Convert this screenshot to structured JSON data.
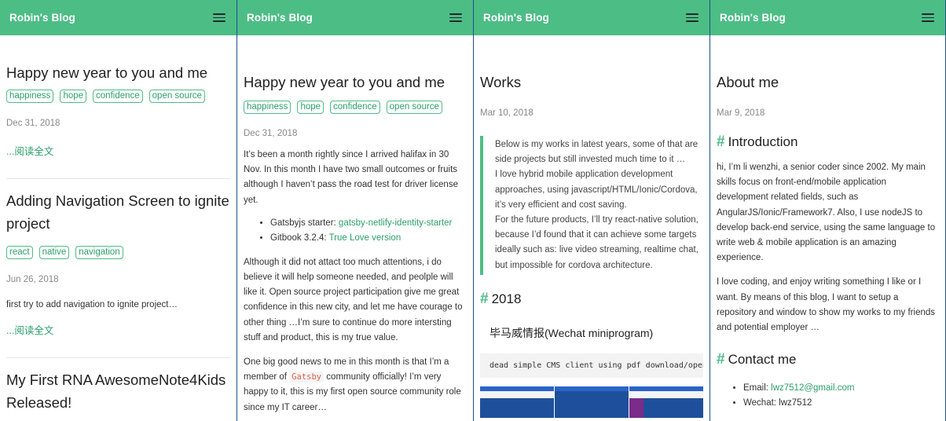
{
  "site": {
    "brand": "Robin's Blog"
  },
  "panel1": {
    "posts": [
      {
        "title": "Happy new year to you and me",
        "tags": [
          "happiness",
          "hope",
          "confidence",
          "open source"
        ],
        "date": "Dec 31, 2018",
        "excerpt": "",
        "read_more": "...阅读全文"
      },
      {
        "title": "Adding Navigation Screen to ignite project",
        "tags": [
          "react",
          "native",
          "navigation"
        ],
        "date": "Jun 26, 2018",
        "excerpt": "first try to add navigation to ignite project…",
        "read_more": "...阅读全文"
      },
      {
        "title": "My First RNA AwesomeNote4Kids Released!"
      }
    ]
  },
  "panel2": {
    "title": "Happy new year to you and me",
    "tags": [
      "happiness",
      "hope",
      "confidence",
      "open source"
    ],
    "date": "Dec 31, 2018",
    "p1": "It’s been a month rightly since I arrived halifax in 30 Nov. In this month I have two small outcomes or fruits although I haven’t pass the road test for driver license yet.",
    "list": [
      {
        "prefix": "Gatsbyjs starter: ",
        "link": "gatsby-netlify-identity-starter"
      },
      {
        "prefix": "Gitbook 3.2.4: ",
        "link": "True Love version"
      }
    ],
    "p2": "Although it did not attact too much attentions, i do believe it will help someone needed, and peolple will like it. Open source project participation give me great confidence in this new city, and let me have courage to other thing …I’m sure to continue do more intersting stuff and product, this is my true value.",
    "p3_a": "One big good news to me in this month is that I’m a member of ",
    "p3_code": "Gatsby",
    "p3_b": " community officially! I’m very happy to it, this is my first open source community role since my IT career…"
  },
  "panel3": {
    "title": "Works",
    "date": "Mar 10, 2018",
    "quote": [
      "Below is my works in latest years, some of that are side projects but still invested much time to it …",
      "I love hybrid mobile application development approaches, using javascript/HTML/Ionic/Cordova, it’s very efficient and cost saving.",
      "For the future products, I’ll try react-native solution, because I’d found that it can achieve some targets ideally such as: live video streaming, realtime chat, but impossible for cordova architecture."
    ],
    "section": "2018",
    "project_title": "毕马威情报(Wechat miniprogram)",
    "code": "dead simple CMS client using pdf download/open"
  },
  "panel4": {
    "title": "About me",
    "date": "Mar 9, 2018",
    "intro_heading": "Introduction",
    "intro_p1": "hi, I’m li wenzhi, a senior coder since 2002. My main skills focus on front-end/mobile application development related fields, such as AngularJS/Ionic/Framework7. Also, I use nodeJS to develop back-end service, using the same language to write web & mobile application is an amazing experience.",
    "intro_p2": "I love coding, and enjoy writing something I like or I want. By means of this blog, I want to setup a repository and window to show my works to my friends and potential employer …",
    "contact_heading": "Contact me",
    "email_label": "Email: ",
    "email": "lwz7512@gmail.com",
    "wechat": "Wechat: lwz7512"
  },
  "colors": {
    "accent": "#4dbd86",
    "link": "#2aa06a",
    "border": "#1f4e8c"
  },
  "icons": {
    "menu": "hamburger-menu-icon",
    "heading": "hash-icon"
  }
}
